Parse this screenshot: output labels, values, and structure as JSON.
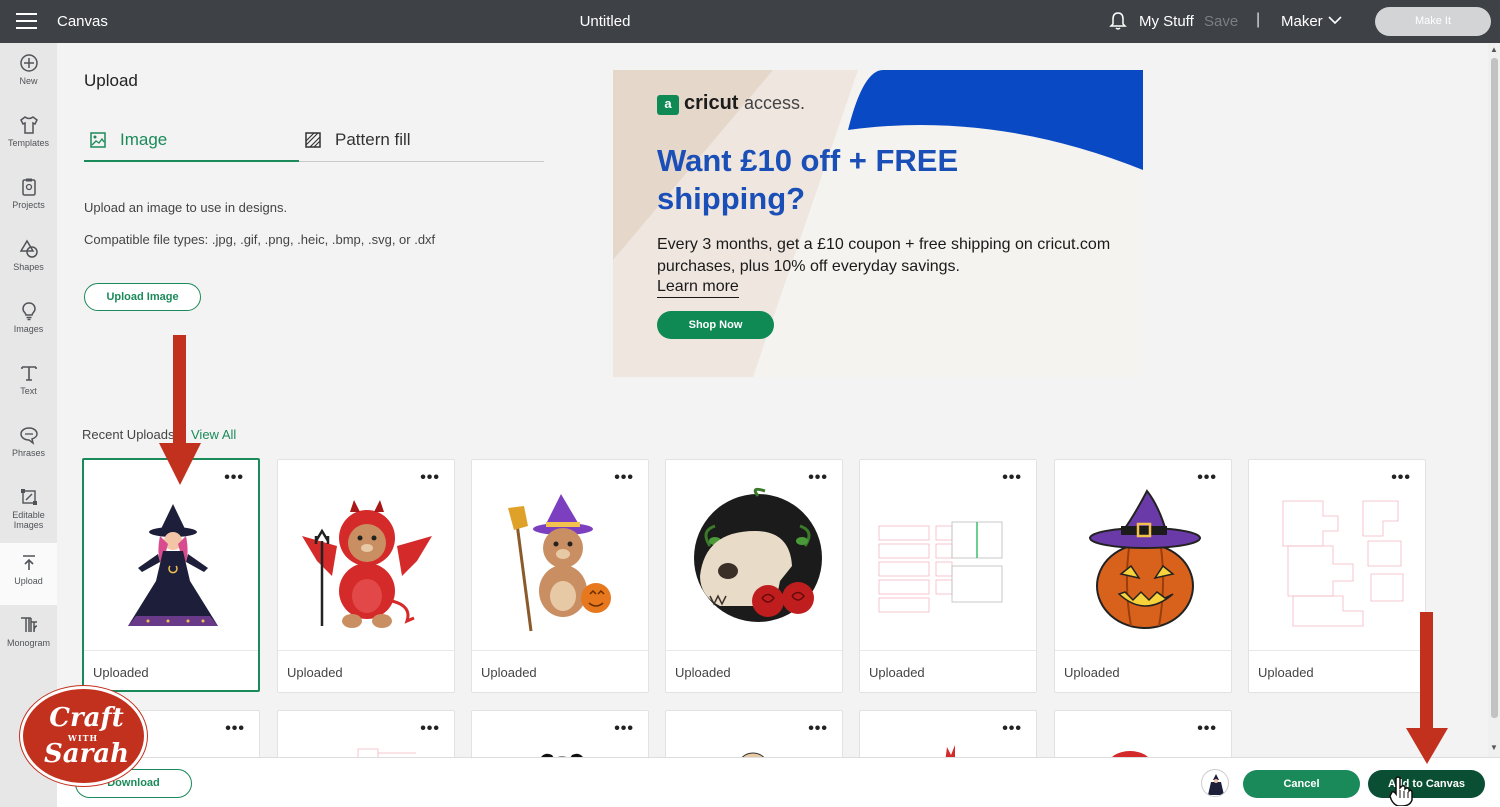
{
  "topbar": {
    "app_title": "Canvas",
    "doc_title": "Untitled",
    "my_stuff": "My Stuff",
    "save": "Save",
    "separator": "|",
    "machine": "Maker",
    "make_it": "Make It"
  },
  "sidebar": {
    "items": [
      {
        "label": "New",
        "icon": "plus-circle-icon"
      },
      {
        "label": "Templates",
        "icon": "shirt-icon"
      },
      {
        "label": "Projects",
        "icon": "clipboard-icon"
      },
      {
        "label": "Shapes",
        "icon": "shapes-icon"
      },
      {
        "label": "Images",
        "icon": "lightbulb-icon"
      },
      {
        "label": "Text",
        "icon": "text-t-icon"
      },
      {
        "label": "Phrases",
        "icon": "speech-bubble-icon"
      },
      {
        "label": "Editable Images",
        "icon": "editable-image-icon"
      },
      {
        "label": "Upload",
        "icon": "upload-icon",
        "active": true
      },
      {
        "label": "Monogram",
        "icon": "monogram-icon"
      }
    ]
  },
  "upload": {
    "title": "Upload",
    "tabs": [
      {
        "label": "Image",
        "active": true
      },
      {
        "label": "Pattern fill",
        "active": false
      }
    ],
    "description": "Upload an image to use in designs.",
    "file_types": "Compatible file types: .jpg, .gif, .png, .heic, .bmp, .svg, or .dxf",
    "upload_button": "Upload Image"
  },
  "ad": {
    "logo_letter": "a",
    "brand": "cricut",
    "brand_suffix": "access.",
    "headline": "Want £10 off + FREE shipping?",
    "body": "Every 3 months, get a £10 coupon + free shipping on cricut.com purchases, plus 10% off everyday savings.",
    "learn_more": "Learn more",
    "cta": "Shop Now",
    "colors": {
      "blue": "#1a4fb8",
      "green": "#0f8a55",
      "beige": "#eee6df"
    }
  },
  "recent": {
    "label": "Recent Uploads",
    "view_all": "View All",
    "more": "•••",
    "items": [
      {
        "caption": "Uploaded",
        "subject": "witch"
      },
      {
        "caption": "Uploaded",
        "subject": "devil-bear"
      },
      {
        "caption": "Uploaded",
        "subject": "witch-bear"
      },
      {
        "caption": "Uploaded",
        "subject": "skull-roses"
      },
      {
        "caption": "Uploaded",
        "subject": "box-template"
      },
      {
        "caption": "Uploaded",
        "subject": "pumpkin-witch-hat"
      },
      {
        "caption": "Uploaded",
        "subject": "pattern-template"
      }
    ]
  },
  "bottom": {
    "download": "Download",
    "cancel": "Cancel",
    "add_to_canvas": "Add to Canvas"
  },
  "watermark": {
    "line1": "Craft",
    "with": "WITH",
    "line2": "Sarah"
  },
  "colors": {
    "accent_green": "#1b8a5a",
    "dark_green": "#0a4f34",
    "topbar": "#3e4145",
    "arrow_red": "#c2311e"
  }
}
